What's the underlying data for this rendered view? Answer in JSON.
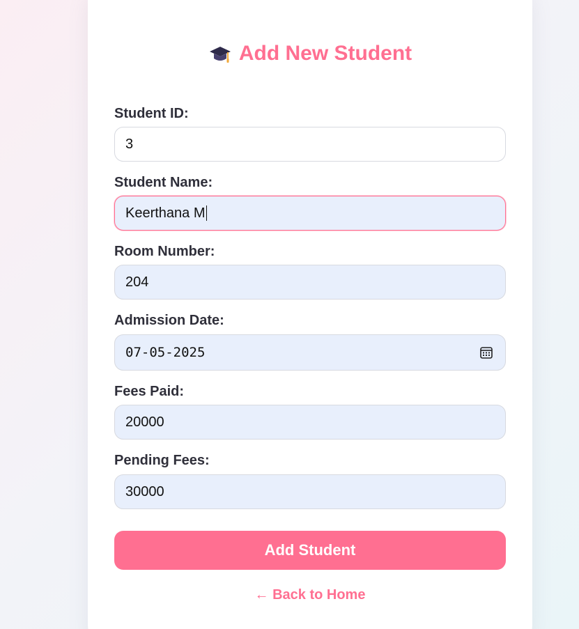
{
  "form": {
    "title": "Add New Student",
    "title_icon": "graduation-cap-icon",
    "fields": [
      {
        "label": "Student ID:",
        "value": "3"
      },
      {
        "label": "Student Name:",
        "value": "Keerthana M"
      },
      {
        "label": "Room Number:",
        "value": "204"
      },
      {
        "label": "Admission Date:",
        "value": "07-05-2025"
      },
      {
        "label": "Fees Paid:",
        "value": "20000"
      },
      {
        "label": "Pending Fees:",
        "value": "30000"
      }
    ],
    "submit_label": "Add Student",
    "back_label": "← Back to Home"
  },
  "colors": {
    "accent": "#ff6f91",
    "input_bg": "#e8effc",
    "label_text": "#2f2f3a"
  }
}
